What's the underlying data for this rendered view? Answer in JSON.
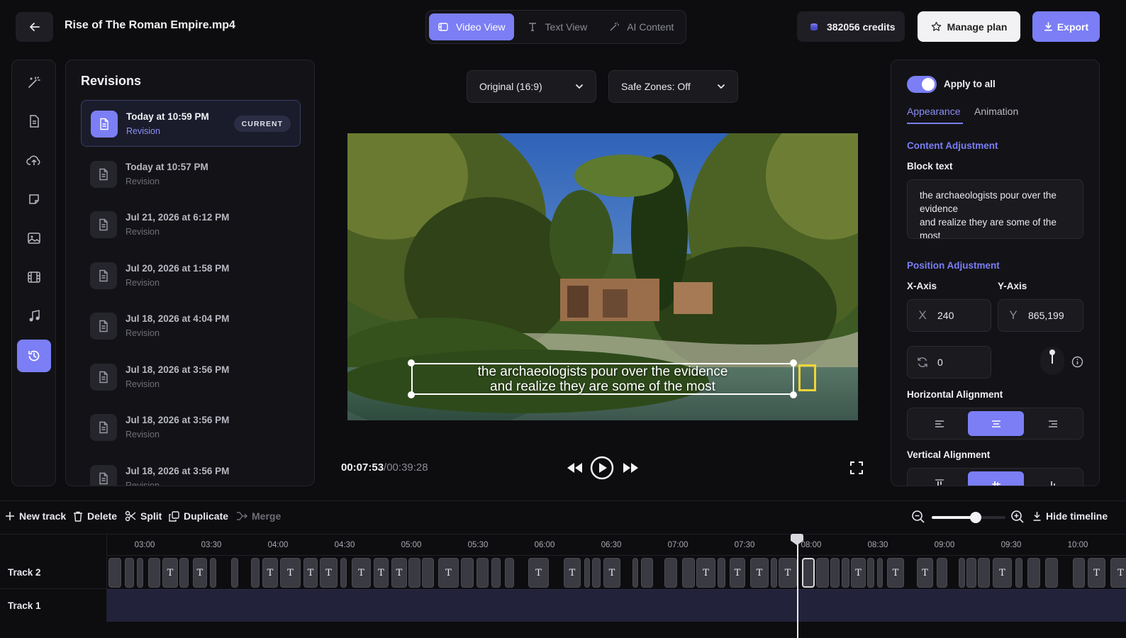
{
  "header": {
    "title": "Rise of The Roman Empire.mp4",
    "tabs": [
      {
        "label": "Video View",
        "active": true
      },
      {
        "label": "Text View",
        "active": false
      },
      {
        "label": "AI Content",
        "active": false
      }
    ],
    "credits": "382056 credits",
    "manage_plan": "Manage plan",
    "export": "Export"
  },
  "revisions": {
    "title": "Revisions",
    "current_badge": "CURRENT",
    "items": [
      {
        "name": "Today at 10:59 PM",
        "sub": "Revision",
        "current": true
      },
      {
        "name": "Today at 10:57 PM",
        "sub": "Revision"
      },
      {
        "name": "Jul 21, 2026 at 6:12 PM",
        "sub": "Revision"
      },
      {
        "name": "Jul 20, 2026 at 1:58 PM",
        "sub": "Revision"
      },
      {
        "name": "Jul 18, 2026 at 4:04 PM",
        "sub": "Revision"
      },
      {
        "name": "Jul 18, 2026 at 3:56 PM",
        "sub": "Revision"
      },
      {
        "name": "Jul 18, 2026 at 3:56 PM",
        "sub": "Revision"
      },
      {
        "name": "Jul 18, 2026 at 3:56 PM",
        "sub": "Revision"
      }
    ]
  },
  "preview": {
    "aspect": "Original (16:9)",
    "safe_zones": "Safe Zones: Off",
    "caption_line1": "the archaeologists pour over the evidence",
    "caption_line2": "and realize they are some of the most",
    "current_time": "00:07:53",
    "separator": "/",
    "total_time": "00:39:28"
  },
  "properties": {
    "apply_to_all": "Apply to all",
    "tab_appearance": "Appearance",
    "tab_animation": "Animation",
    "content_adjustment": "Content Adjustment",
    "block_text_label": "Block text",
    "block_text": "the archaeologists pour over the evidence\nand realize they are some of the most",
    "position_adjustment": "Position Adjustment",
    "x_axis_label": "X-Axis",
    "y_axis_label": "Y-Axis",
    "x_prefix": "X",
    "y_prefix": "Y",
    "x_value": "240",
    "y_value": "865,199",
    "rotation_value": "0",
    "horizontal_alignment": "Horizontal Alignment",
    "vertical_alignment": "Vertical Alignment"
  },
  "timeline": {
    "tools": {
      "new_track": "New track",
      "delete": "Delete",
      "split": "Split",
      "duplicate": "Duplicate",
      "merge": "Merge",
      "hide_timeline": "Hide timeline"
    },
    "zoom_level": 0.6,
    "ticks": [
      "03:00",
      "03:30",
      "04:00",
      "04:30",
      "05:00",
      "05:30",
      "06:00",
      "06:30",
      "07:00",
      "07:30",
      "08:00",
      "08:30",
      "09:00",
      "09:30",
      "10:00"
    ],
    "tracks": [
      {
        "label": "Track 2"
      },
      {
        "label": "Track 1"
      }
    ],
    "clip_glyph": "T"
  },
  "colors": {
    "accent": "#7b7ef5",
    "caption_highlight": "#f0d43a"
  }
}
